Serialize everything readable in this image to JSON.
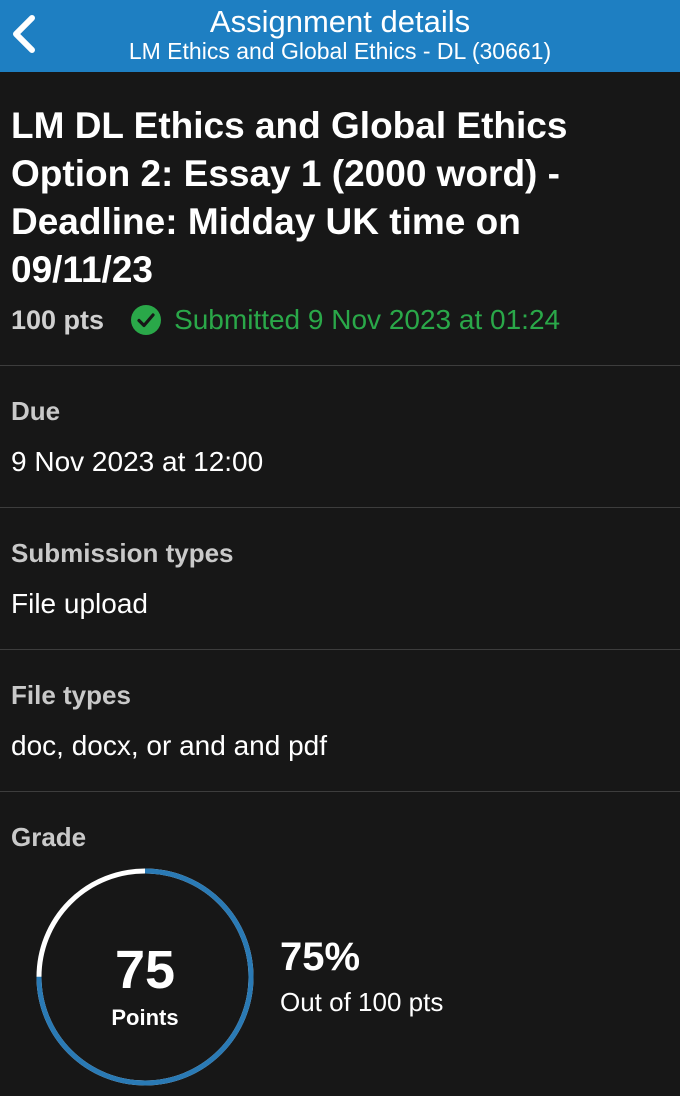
{
  "header": {
    "title": "Assignment details",
    "subtitle": "LM Ethics and Global Ethics - DL (30661)",
    "back_icon": "chevron-left-icon"
  },
  "assignment": {
    "title": "LM DL Ethics and Global Ethics Option 2: Essay 1 (2000 word)  - Deadline: Midday UK time on 09/11/23",
    "points": "100 pts",
    "status_icon": "check-circle-icon",
    "status": "Submitted 9 Nov 2023 at 01:24"
  },
  "sections": {
    "due": {
      "label": "Due",
      "value": "9 Nov 2023 at 12:00"
    },
    "submission_types": {
      "label": "Submission types",
      "value": "File upload"
    },
    "file_types": {
      "label": "File types",
      "value": "doc, docx, or and and pdf"
    }
  },
  "grade": {
    "label": "Grade",
    "points": "75",
    "points_unit": "Points",
    "fraction": 0.75,
    "percent": "75%",
    "out_of": "Out of 100 pts"
  },
  "colors": {
    "header_bg": "#1e7fc2",
    "success": "#2aa849",
    "ring_progress": "#2a7ab5",
    "ring_track": "#ffffff",
    "background": "#171717"
  }
}
